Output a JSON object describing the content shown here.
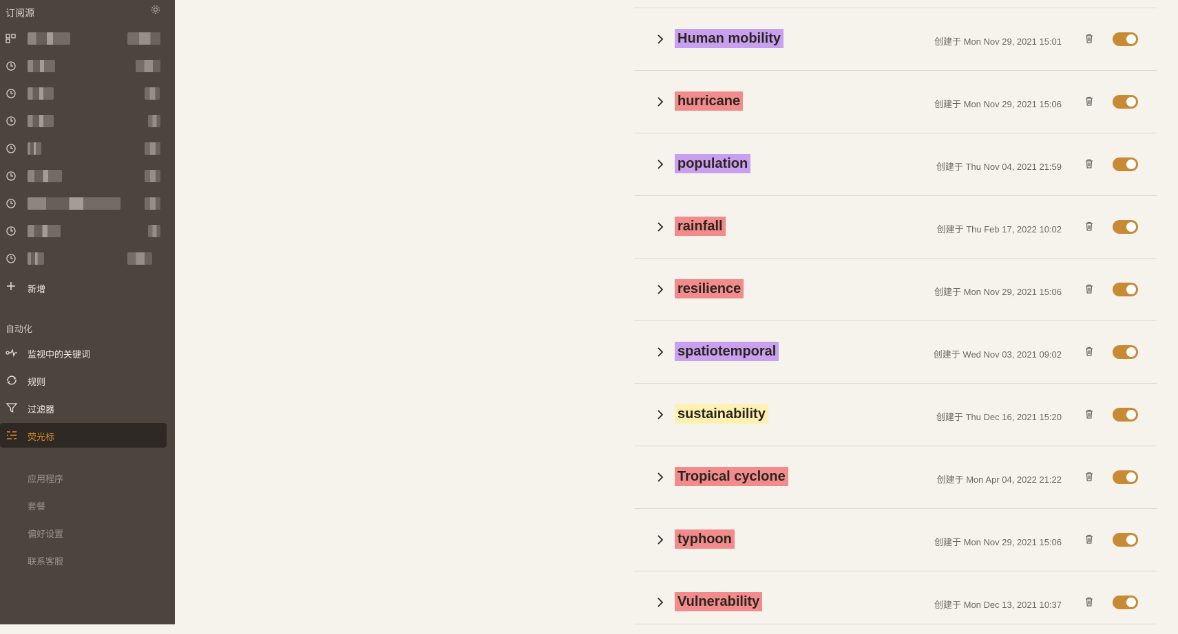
{
  "sidebar": {
    "title": "订阅源",
    "settings_icon": "gear-icon",
    "add_label": "新增",
    "automation_title": "自动化",
    "nav": [
      {
        "label": "监视中的关键词",
        "icon": "keyword-watch-icon"
      },
      {
        "label": "规则",
        "icon": "rules-icon"
      },
      {
        "label": "过滤器",
        "icon": "filter-icon"
      },
      {
        "label": "荧光标",
        "icon": "highlighter-icon",
        "active": true
      }
    ],
    "links": [
      "应用程序",
      "套餐",
      "偏好设置",
      "联系客服"
    ]
  },
  "highlights": [
    {
      "keyword": "Human mobility",
      "date": "创建于 Mon Nov 29, 2021 15:01",
      "color": "#c9a0f0",
      "enabled": true
    },
    {
      "keyword": "hurricane",
      "date": "创建于 Mon Nov 29, 2021 15:06",
      "color": "#f28b8b",
      "enabled": true
    },
    {
      "keyword": "population",
      "date": "创建于 Thu Nov 04, 2021 21:59",
      "color": "#c9a0f0",
      "enabled": true
    },
    {
      "keyword": "rainfall",
      "date": "创建于 Thu Feb 17, 2022 10:02",
      "color": "#f28b8b",
      "enabled": true
    },
    {
      "keyword": "resilience",
      "date": "创建于 Mon Nov 29, 2021 15:06",
      "color": "#f28b8b",
      "enabled": true
    },
    {
      "keyword": "spatiotemporal",
      "date": "创建于 Wed Nov 03, 2021 09:02",
      "color": "#c9a0f0",
      "enabled": true
    },
    {
      "keyword": "sustainability",
      "date": "创建于 Thu Dec 16, 2021 15:20",
      "color": "#fdf0b0",
      "enabled": true
    },
    {
      "keyword": "Tropical cyclone",
      "date": "创建于 Mon Apr 04, 2022 21:22",
      "color": "#f28b8b",
      "enabled": true
    },
    {
      "keyword": "typhoon",
      "date": "创建于 Mon Nov 29, 2021 15:06",
      "color": "#f28b8b",
      "enabled": true
    },
    {
      "keyword": "Vulnerability",
      "date": "创建于 Mon Dec 13, 2021 10:37",
      "color": "#f28b8b",
      "enabled": true
    }
  ],
  "colors": {
    "accent": "#c98a35",
    "sidebar_bg": "#4b453e",
    "page_bg": "#f6f2ec"
  }
}
